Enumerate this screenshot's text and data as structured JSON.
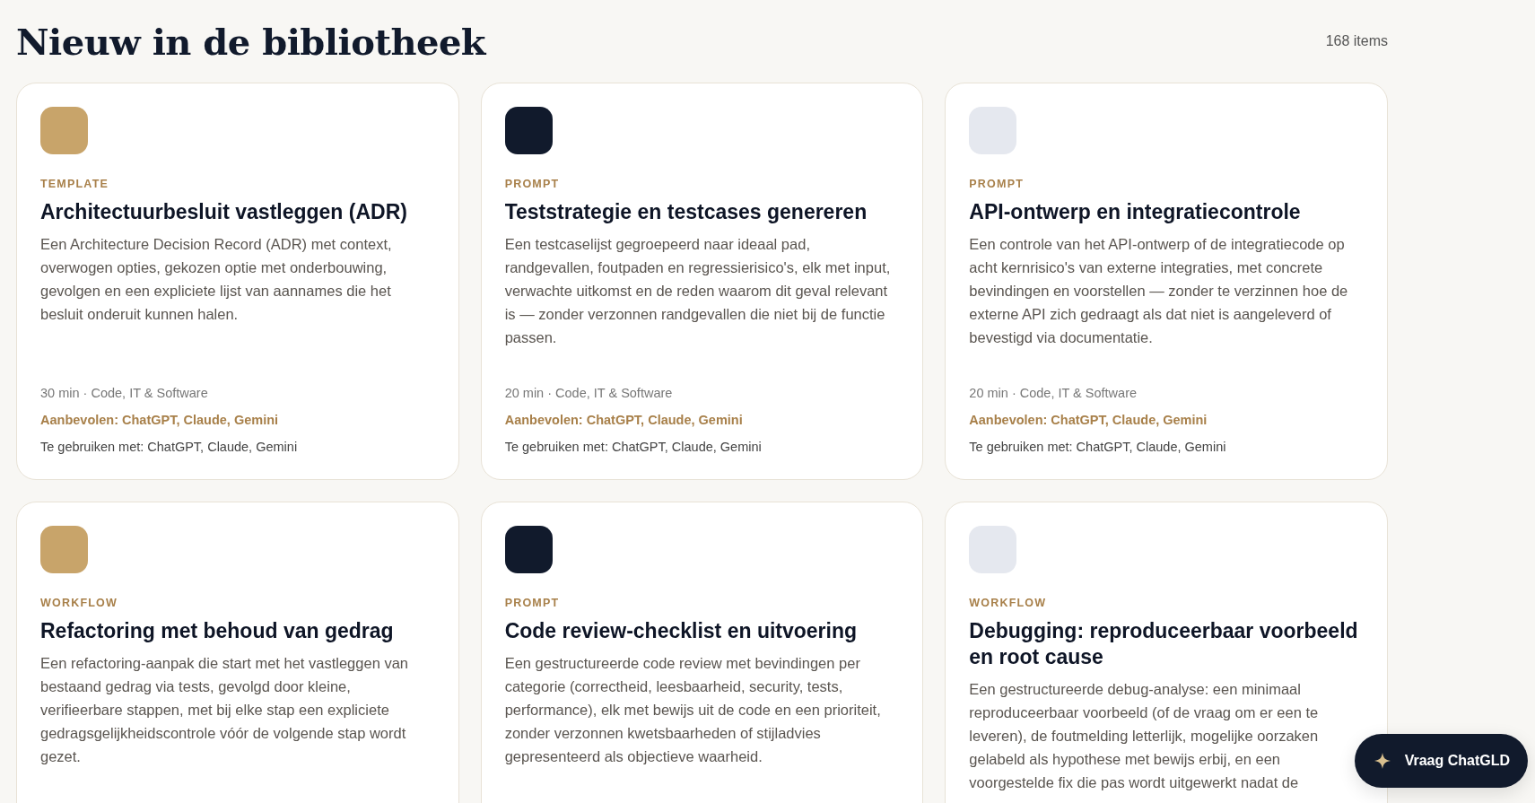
{
  "page": {
    "title": "Nieuw in de bibliotheek",
    "count": "168 items"
  },
  "cards": [
    {
      "color": "#c8a46a",
      "type": "TEMPLATE",
      "title": "Architectuurbesluit vastleggen (ADR)",
      "description": "Een Architecture Decision Record (ADR) met context, overwogen opties, gekozen optie met onderbouwing, gevolgen en een expliciete lijst van aannames die het besluit onderuit kunnen halen.",
      "meta": "30 min · Code, IT & Software",
      "recommended": "Aanbevolen: ChatGPT, Claude, Gemini",
      "usable_with": "Te gebruiken met: ChatGPT, Claude, Gemini"
    },
    {
      "color": "#111a2c",
      "type": "PROMPT",
      "title": "Teststrategie en testcases genereren",
      "description": "Een testcaselijst gegroepeerd naar ideaal pad, randgevallen, foutpaden en regressierisico's, elk met input, verwachte uitkomst en de reden waarom dit geval relevant is — zonder verzonnen randgevallen die niet bij de functie passen.",
      "meta": "20 min · Code, IT & Software",
      "recommended": "Aanbevolen: ChatGPT, Claude, Gemini",
      "usable_with": "Te gebruiken met: ChatGPT, Claude, Gemini"
    },
    {
      "color": "#e5e8ef",
      "type": "PROMPT",
      "title": "API-ontwerp en integratiecontrole",
      "description": "Een controle van het API-ontwerp of de integratiecode op acht kernrisico's van externe integraties, met concrete bevindingen en voorstellen — zonder te verzinnen hoe de externe API zich gedraagt als dat niet is aangeleverd of bevestigd via documentatie.",
      "meta": "20 min · Code, IT & Software",
      "recommended": "Aanbevolen: ChatGPT, Claude, Gemini",
      "usable_with": "Te gebruiken met: ChatGPT, Claude, Gemini"
    },
    {
      "color": "#c8a46a",
      "type": "WORKFLOW",
      "title": "Refactoring met behoud van gedrag",
      "description": "Een refactoring-aanpak die start met het vastleggen van bestaand gedrag via tests, gevolgd door kleine, verifieerbare stappen, met bij elke stap een expliciete gedragsgelijkheidscontrole vóór de volgende stap wordt gezet."
    },
    {
      "color": "#111a2c",
      "type": "PROMPT",
      "title": "Code review-checklist en uitvoering",
      "description": "Een gestructureerde code review met bevindingen per categorie (correctheid, leesbaarheid, security, tests, performance), elk met bewijs uit de code en een prioriteit, zonder verzonnen kwetsbaarheden of stijladvies gepresenteerd als objectieve waarheid."
    },
    {
      "color": "#e5e8ef",
      "type": "WORKFLOW",
      "title": "Debugging: reproduceerbaar voorbeeld en root cause",
      "description": "Een gestructureerde debug-analyse: een minimaal reproduceerbaar voorbeeld (of de vraag om er een te leveren), de foutmelding letterlijk, mogelijke oorzaken gelabeld als hypothese met bewijs erbij, en een voorgestelde fix die pas wordt uitgewerkt nadat de"
    }
  ],
  "assistant_button": {
    "label": "Vraag ChatGLD"
  }
}
